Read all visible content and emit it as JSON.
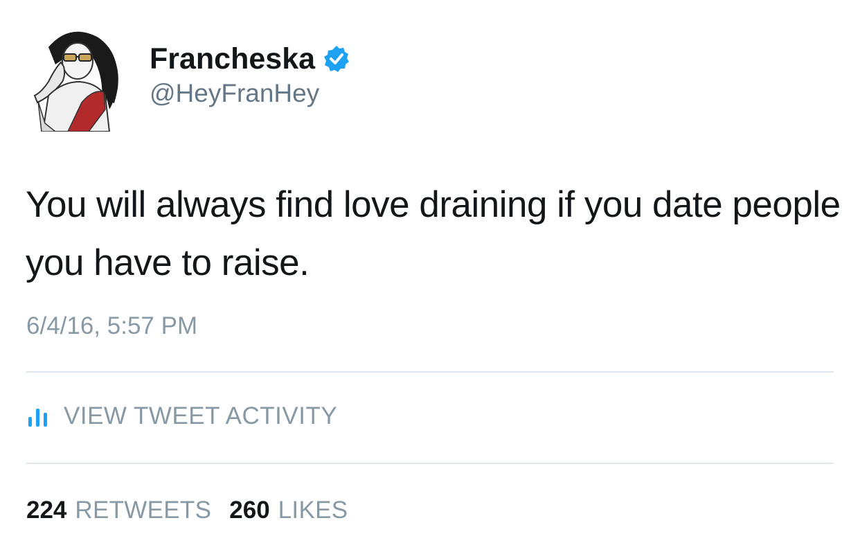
{
  "author": {
    "display_name": "Francheska",
    "handle": "@HeyFranHey",
    "verified": true,
    "avatar_icon": "illustrated-person-avatar"
  },
  "tweet": {
    "text": "You will always find love draining if you date people you have to raise.",
    "timestamp": "6/4/16, 5:57 PM"
  },
  "activity": {
    "label": "VIEW TWEET ACTIVITY",
    "icon": "bar-chart-icon"
  },
  "stats": {
    "retweets_count": "224",
    "retweets_label": "RETWEETS",
    "likes_count": "260",
    "likes_label": "LIKES"
  },
  "colors": {
    "primary_text": "#14171a",
    "secondary_text": "#8899a6",
    "verified_blue": "#1da1f2",
    "divider": "#e1e8ed"
  }
}
